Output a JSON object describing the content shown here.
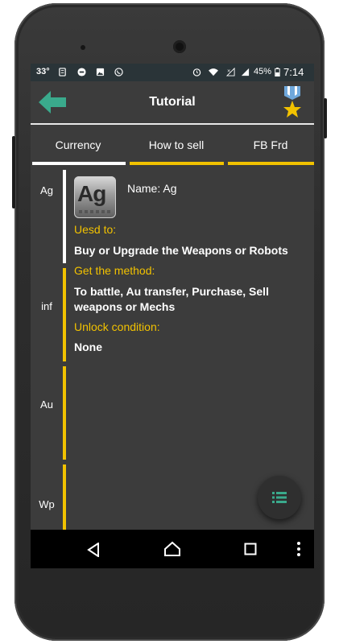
{
  "status_bar": {
    "temperature": "33°",
    "battery_percent": "45%",
    "time": "7:14",
    "icons": [
      "notes-icon",
      "minus-circle-icon",
      "image-icon",
      "whatsapp-icon",
      "alarm-icon",
      "wifi-icon",
      "no-signal-icon",
      "cell-signal-icon",
      "battery-icon"
    ]
  },
  "header": {
    "title": "Tutorial",
    "back_icon": "back-arrow-icon",
    "badge_icon": "medal-star-icon",
    "accent_color": "#3aaa8c"
  },
  "tabs": [
    {
      "label": "Currency",
      "active": true
    },
    {
      "label": "How to sell",
      "active": false
    },
    {
      "label": "FB Frd",
      "active": false
    }
  ],
  "sidebar": {
    "items": [
      {
        "label": "Ag"
      },
      {
        "label": "inf"
      },
      {
        "label": "Au"
      },
      {
        "label": "Wp"
      }
    ]
  },
  "detail": {
    "icon_symbol": "Ag",
    "name": "Name: Ag",
    "used_to_label": "Uesd to:",
    "used_to_value": "Buy or Upgrade the Weapons or Robots",
    "method_label": "Get the method:",
    "method_value": "To battle, Au transfer, Purchase, Sell weapons or Mechs",
    "unlock_label": "Unlock condition:",
    "unlock_value": "None"
  },
  "fab": {
    "icon": "list-icon"
  },
  "nav_bar": {
    "icons": [
      "back-triangle-icon",
      "home-circle-icon",
      "recents-square-icon",
      "more-dots-icon"
    ]
  },
  "colors": {
    "highlight_yellow": "#f2c200",
    "active_white": "#ffffff",
    "screen_bg": "#3c3c3c"
  }
}
